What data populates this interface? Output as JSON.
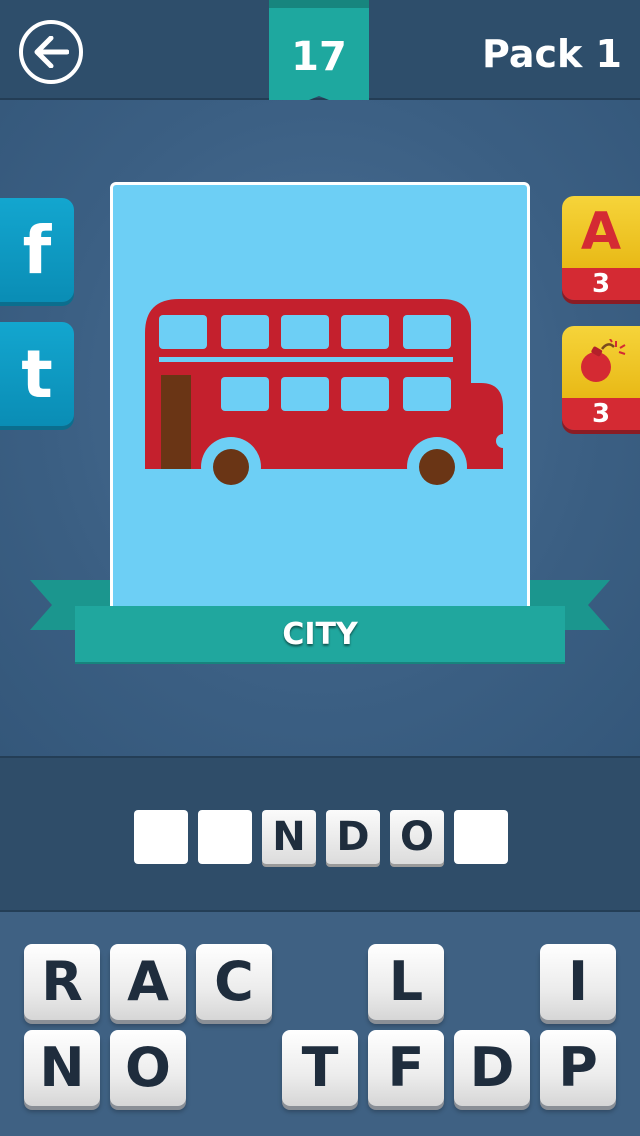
{
  "header": {
    "level": "17",
    "pack_label": "Pack 1",
    "back_icon": "arrow-left-circle-icon",
    "colors": {
      "bar": "#2e4e6b",
      "ribbon": "#1ea89f"
    }
  },
  "social": {
    "facebook_label": "f",
    "twitter_label": "t"
  },
  "hints": {
    "reveal_letter": {
      "label": "A",
      "count": "3"
    },
    "remove_letters": {
      "icon": "bomb-icon",
      "count": "3"
    }
  },
  "puzzle": {
    "image_icon": "double-decker-bus-icon",
    "category": "CITY"
  },
  "answer": {
    "slots": [
      "",
      "",
      "N",
      "D",
      "O",
      ""
    ]
  },
  "keyboard": {
    "row1": [
      "R",
      "A",
      "C",
      "",
      "L",
      "",
      "I"
    ],
    "row2": [
      "N",
      "O",
      "",
      "T",
      "F",
      "D",
      "P"
    ]
  }
}
